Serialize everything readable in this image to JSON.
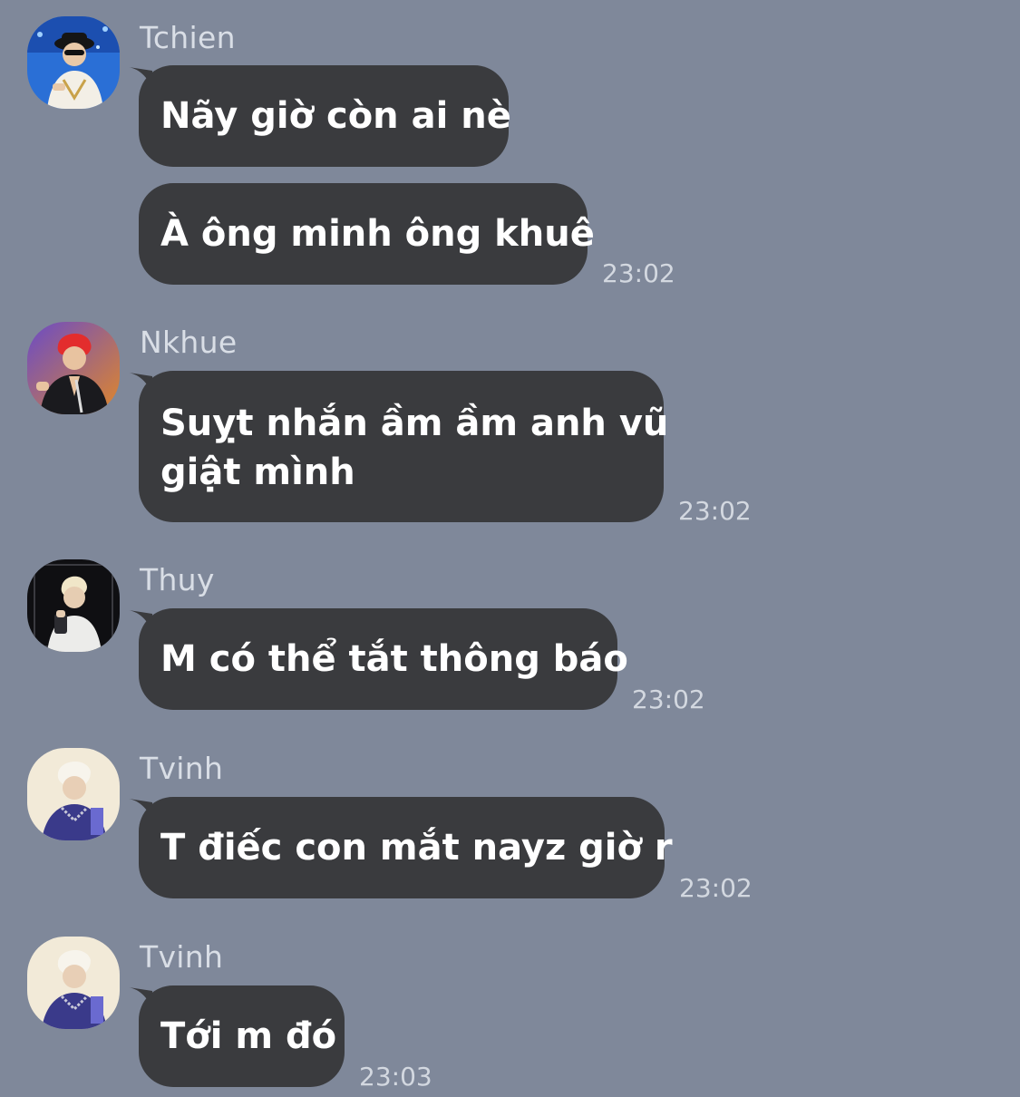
{
  "messages": [
    {
      "sender": "Tchien",
      "bubbles": [
        "Nãy giờ còn ai nè",
        "À ông minh ông khuê"
      ],
      "time": "23:02"
    },
    {
      "sender": "Nkhue",
      "bubbles": [
        "Suỵt nhắn ầm ầm anh vũ giật mình"
      ],
      "lines": [
        "Suỵt nhắn ầm ầm anh vũ",
        "giật mình"
      ],
      "time": "23:02"
    },
    {
      "sender": "Thuy",
      "bubbles": [
        "M có thể tắt thông báo"
      ],
      "time": "23:02"
    },
    {
      "sender": "Tvinh",
      "bubbles": [
        "T điếc con mắt nayz giờ r"
      ],
      "time": "23:02"
    },
    {
      "sender": "Tvinh",
      "bubbles": [
        "Tới m đó"
      ],
      "time": "23:03"
    }
  ],
  "colors": {
    "background": "#7f889a",
    "bubble": "#3a3b3e",
    "bubble_text": "#ffffff",
    "meta_text": "#d9dee6"
  }
}
